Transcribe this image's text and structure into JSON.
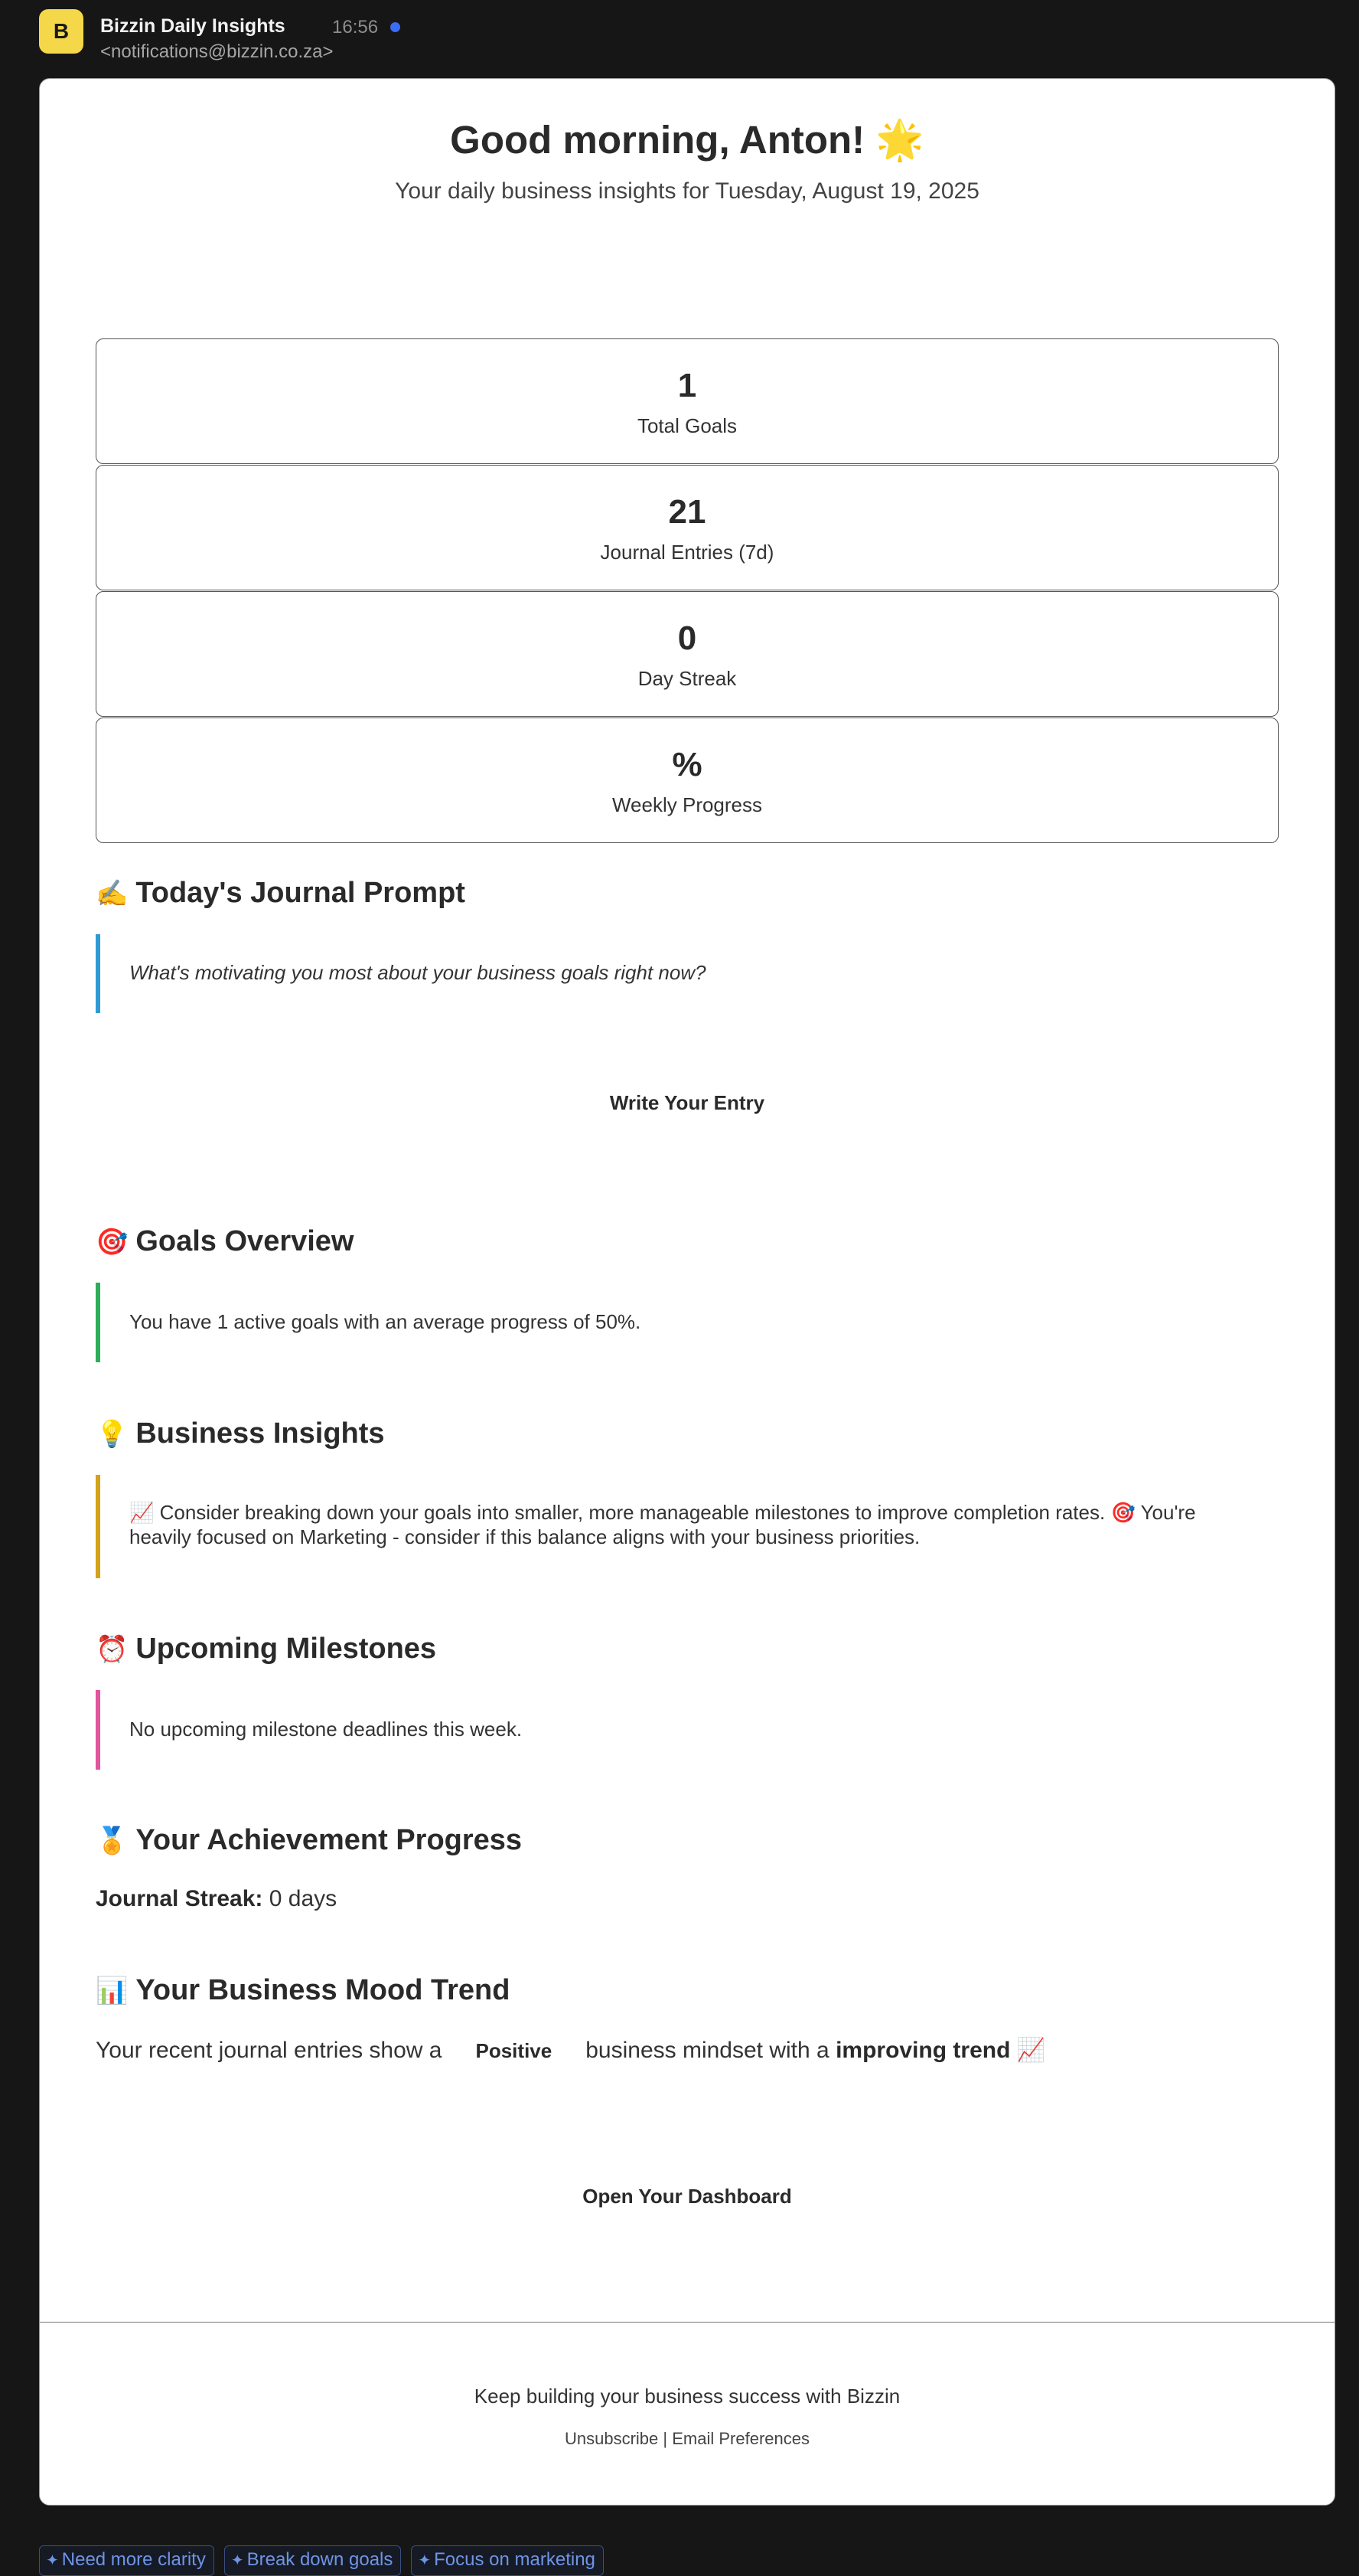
{
  "sender": {
    "avatar_letter": "B",
    "name": "Bizzin Daily Insights",
    "time": "16:56",
    "email": "<notifications@bizzin.co.za>",
    "unread_color": "#3b6cf6"
  },
  "header": {
    "greeting": "Good morning, Anton! 🌟",
    "subtitle": "Your daily business insights for Tuesday, August 19, 2025"
  },
  "stats": [
    {
      "value": "1",
      "label": "Total Goals"
    },
    {
      "value": "21",
      "label": "Journal Entries (7d)"
    },
    {
      "value": "0",
      "label": "Day Streak"
    },
    {
      "value": "%",
      "label": "Weekly Progress"
    }
  ],
  "journal_prompt": {
    "emoji": "✍️",
    "title": "Today's Journal Prompt",
    "prompt": "What's motivating you most about your business goals right now?",
    "accent": "#2e9bd6",
    "cta": "Write Your Entry"
  },
  "goals_overview": {
    "emoji": "🎯",
    "title": "Goals Overview",
    "text": "You have 1 active goals with an average progress of 50%.",
    "accent": "#2fae5a"
  },
  "business_insights": {
    "emoji": "💡",
    "title": "Business Insights",
    "text": "📈 Consider breaking down your goals into smaller, more manageable milestones to improve completion rates. 🎯 You're heavily focused on Marketing - consider if this balance aligns with your business priorities.",
    "accent": "#d4a21a"
  },
  "upcoming_milestones": {
    "emoji": "⏰",
    "title": "Upcoming Milestones",
    "text": "No upcoming milestone deadlines this week.",
    "accent": "#e0559b"
  },
  "achievement": {
    "emoji": "🏅",
    "title": "Your Achievement Progress",
    "streak_label": "Journal Streak:",
    "streak_value": "0 days"
  },
  "mood": {
    "emoji": "📊",
    "title": "Your Business Mood Trend",
    "prefix": "Your recent journal entries show a",
    "badge": "Positive",
    "middle": "business mindset with a",
    "trend": "improving trend",
    "trend_emoji": "📈"
  },
  "dashboard_cta": "Open Your Dashboard",
  "footer": {
    "text": "Keep building your business success with Bizzin",
    "unsubscribe": "Unsubscribe",
    "separator": "|",
    "preferences": "Email Preferences"
  },
  "chips": [
    {
      "label": "Need more clarity"
    },
    {
      "label": "Break down goals"
    },
    {
      "label": "Focus on marketing"
    }
  ]
}
